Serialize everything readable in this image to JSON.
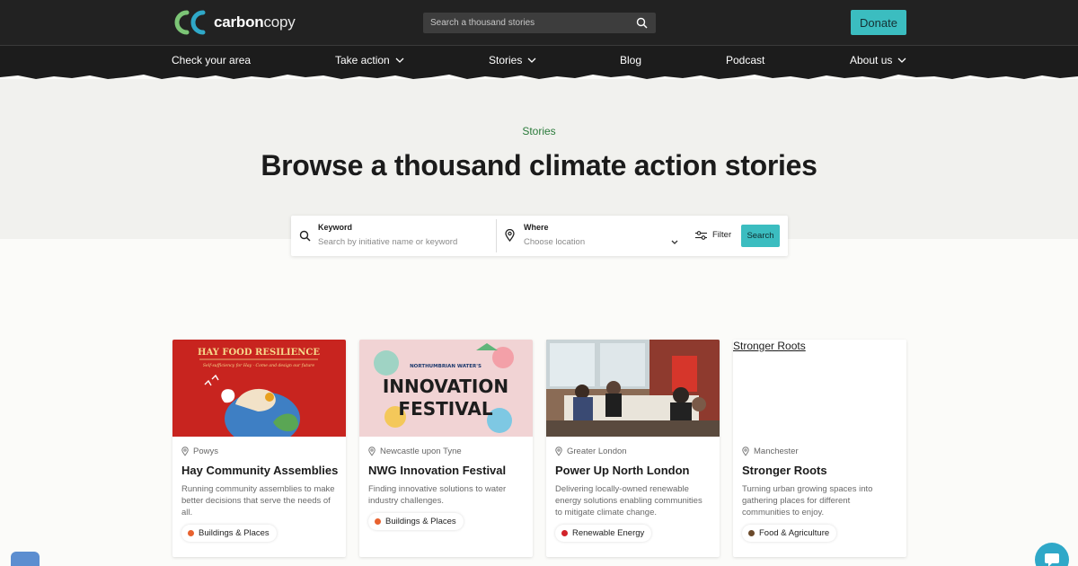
{
  "header": {
    "logo": {
      "part1": "carbon",
      "part2": "copy"
    },
    "search": {
      "placeholder": "Search a thousand stories"
    },
    "donate_label": "Donate"
  },
  "nav": {
    "items": [
      {
        "label": "Check your area",
        "dropdown": false
      },
      {
        "label": "Take action",
        "dropdown": true
      },
      {
        "label": "Stories",
        "dropdown": true
      },
      {
        "label": "Blog",
        "dropdown": false
      },
      {
        "label": "Podcast",
        "dropdown": false
      },
      {
        "label": "About us",
        "dropdown": true
      }
    ]
  },
  "hero": {
    "eyebrow": "Stories",
    "title": "Browse a thousand climate action stories"
  },
  "search_panel": {
    "keyword_label": "Keyword",
    "keyword_placeholder": "Search by initiative name or keyword",
    "where_label": "Where",
    "where_placeholder": "Choose location",
    "filter_label": "Filter",
    "search_label": "Search"
  },
  "cards": [
    {
      "image_text": {
        "heading": "HAY FOOD RESILIENCE",
        "sub": "Self-sufficiency for Hay · Come and design our future"
      },
      "location": "Powys",
      "title": "Hay Community Assemblies",
      "description": "Running community assemblies to make better decisions that serve the needs of all.",
      "tag": "Buildings & Places",
      "tag_color": "#e8622f"
    },
    {
      "image_text": {
        "top": "NORTHUMBRIAN WATER'S",
        "line1": "INNOVATION",
        "line2": "FESTIVAL"
      },
      "location": "Newcastle upon Tyne",
      "title": "NWG Innovation Festival",
      "description": "Finding innovative solutions to water industry challenges.",
      "tag": "Buildings & Places",
      "tag_color": "#e8622f"
    },
    {
      "location": "Greater London",
      "title": "Power Up North London",
      "description": "Delivering locally-owned renewable energy solutions enabling communities to mitigate climate change.",
      "tag": "Renewable Energy",
      "tag_color": "#d2232a"
    },
    {
      "image_alt": "Stronger Roots",
      "location": "Manchester",
      "title": "Stronger Roots",
      "description": "Turning urban growing spaces into gathering places for different communities to enjoy.",
      "tag": "Food & Agriculture",
      "tag_color": "#6b4a2b"
    }
  ],
  "colors": {
    "accent": "#3bbdc0",
    "header_bg": "#222222",
    "eyebrow_green": "#2a7a3a"
  },
  "icons": [
    "search-icon",
    "chevron-down-icon",
    "map-pin-icon",
    "filter-icon",
    "chat-icon"
  ]
}
